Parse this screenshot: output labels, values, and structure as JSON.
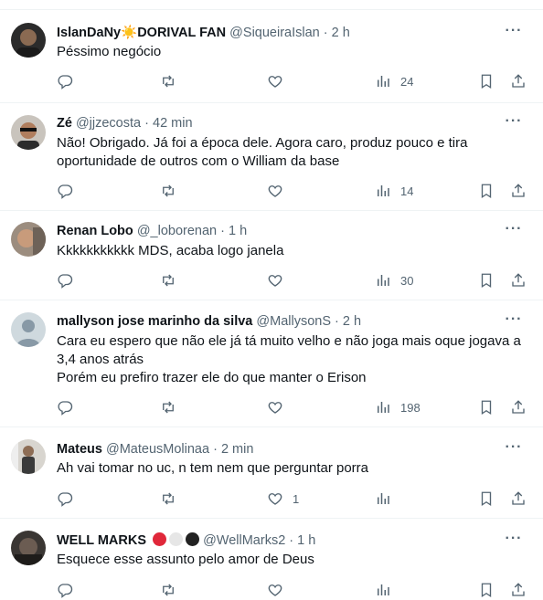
{
  "tweets": [
    {
      "name": "IslanDaNy",
      "name_emoji": "☀️",
      "name_suffix": "DORIVAL FAN",
      "handle": "@SiqueiraIslan",
      "dot": "·",
      "time": "2 h",
      "lines": [
        "Péssimo negócio"
      ],
      "views": "24",
      "likes": ""
    },
    {
      "name": "Zé",
      "handle": "@jjzecosta",
      "dot": "·",
      "time": "42 min",
      "lines": [
        "Não! Obrigado. Já foi a época dele. Agora caro, produz pouco e tira",
        "oportunidade de outros com o William da base"
      ],
      "views": "14",
      "likes": ""
    },
    {
      "name": "Renan Lobo",
      "handle": "@_loborenan",
      "dot": "·",
      "time": "1 h",
      "lines": [
        "Kkkkkkkkkkk MDS, acaba logo janela"
      ],
      "views": "30",
      "likes": ""
    },
    {
      "name": "mallyson jose marinho da silva",
      "handle": "@MallysonS",
      "dot": "·",
      "time": "2 h",
      "lines": [
        "Cara eu espero que não ele já tá muito velho e não joga mais oque jogava a",
        "3,4 anos atrás",
        "Porém eu prefiro trazer ele do que manter o Erison"
      ],
      "views": "198",
      "likes": ""
    },
    {
      "name": "Mateus",
      "handle": "@MateusMolinaa",
      "dot": "·",
      "time": "2 min",
      "lines": [
        "Ah vai tomar no uc, n tem nem que perguntar porra"
      ],
      "views": "",
      "likes": "1"
    },
    {
      "name": "WELL MARKS",
      "name_badges": [
        "#e0283a",
        "#e6e6e6",
        "#222222"
      ],
      "handle": "@WellMarks2",
      "dot": "·",
      "time": "1 h",
      "lines": [
        "Esquece esse assunto pelo amor de Deus"
      ],
      "views": "",
      "likes": ""
    }
  ],
  "colors": {
    "text": "#0f1419",
    "muted": "#536471",
    "border": "#eff3f4"
  },
  "icons": [
    "reply-icon",
    "retweet-icon",
    "like-icon",
    "views-icon",
    "bookmark-icon",
    "share-icon",
    "more-icon"
  ]
}
